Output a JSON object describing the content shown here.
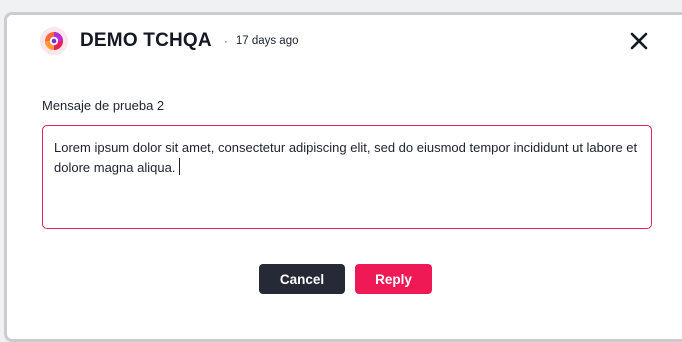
{
  "post": {
    "author": "DEMO TCHQA",
    "separator": "·",
    "timestamp": "17 days ago",
    "message": "Mensaje de prueba 2"
  },
  "reply": {
    "text": "Lorem ipsum dolor sit amet, consectetur adipiscing elit, sed do eiusmod tempor incididunt ut labore et dolore magna aliqua."
  },
  "actions": {
    "cancel_label": "Cancel",
    "reply_label": "Reply"
  },
  "colors": {
    "accent": "#ef1a55",
    "input_border": "#e8235c",
    "cancel_bg": "#262a36"
  },
  "icons": {
    "avatar": "brand-swirl-icon",
    "close": "close-icon"
  }
}
